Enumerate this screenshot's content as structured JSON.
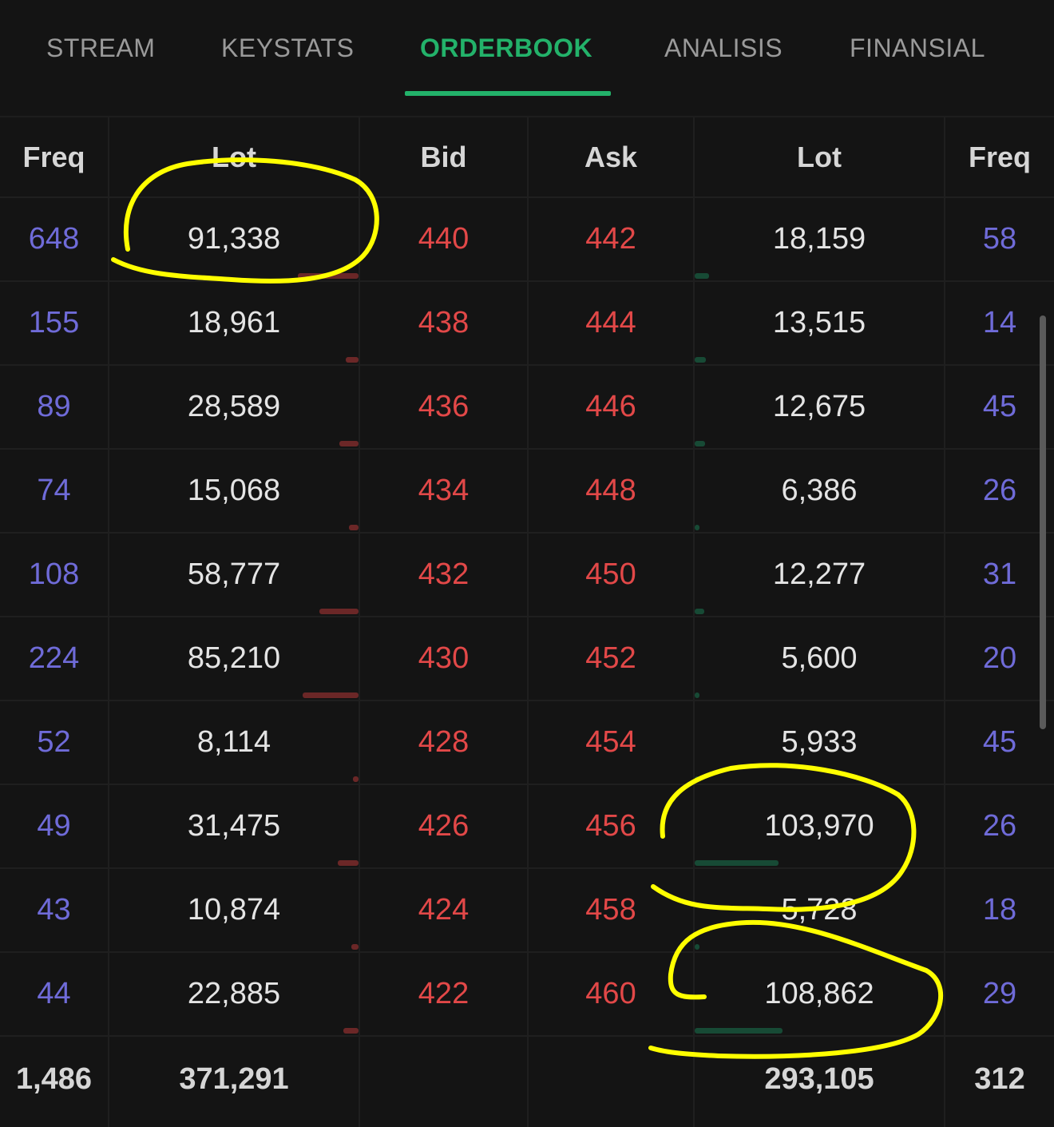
{
  "tabs": [
    {
      "label": "STREAM",
      "active": false
    },
    {
      "label": "KEYSTATS",
      "active": false
    },
    {
      "label": "ORDERBOOK",
      "active": true
    },
    {
      "label": "ANALISIS",
      "active": false
    },
    {
      "label": "FINANSIAL",
      "active": false
    }
  ],
  "orderbook": {
    "headers": {
      "bid_freq": "Freq",
      "bid_lot": "Lot",
      "bid": "Bid",
      "ask": "Ask",
      "ask_lot": "Lot",
      "ask_freq": "Freq"
    },
    "rows": [
      {
        "bid_freq": "648",
        "bid_lot": "91,338",
        "bid": "440",
        "ask": "442",
        "ask_lot": "18,159",
        "ask_freq": "58"
      },
      {
        "bid_freq": "155",
        "bid_lot": "18,961",
        "bid": "438",
        "ask": "444",
        "ask_lot": "13,515",
        "ask_freq": "14"
      },
      {
        "bid_freq": "89",
        "bid_lot": "28,589",
        "bid": "436",
        "ask": "446",
        "ask_lot": "12,675",
        "ask_freq": "45"
      },
      {
        "bid_freq": "74",
        "bid_lot": "15,068",
        "bid": "434",
        "ask": "448",
        "ask_lot": "6,386",
        "ask_freq": "26"
      },
      {
        "bid_freq": "108",
        "bid_lot": "58,777",
        "bid": "432",
        "ask": "450",
        "ask_lot": "12,277",
        "ask_freq": "31"
      },
      {
        "bid_freq": "224",
        "bid_lot": "85,210",
        "bid": "430",
        "ask": "452",
        "ask_lot": "5,600",
        "ask_freq": "20"
      },
      {
        "bid_freq": "52",
        "bid_lot": "8,114",
        "bid": "428",
        "ask": "454",
        "ask_lot": "5,933",
        "ask_freq": "45"
      },
      {
        "bid_freq": "49",
        "bid_lot": "31,475",
        "bid": "426",
        "ask": "456",
        "ask_lot": "103,970",
        "ask_freq": "26"
      },
      {
        "bid_freq": "43",
        "bid_lot": "10,874",
        "bid": "424",
        "ask": "458",
        "ask_lot": "5,728",
        "ask_freq": "18"
      },
      {
        "bid_freq": "44",
        "bid_lot": "22,885",
        "bid": "422",
        "ask": "460",
        "ask_lot": "108,862",
        "ask_freq": "29"
      }
    ],
    "totals": {
      "bid_freq": "1,486",
      "bid_lot": "371,291",
      "ask_lot": "293,105",
      "ask_freq": "312"
    }
  },
  "colors": {
    "accent": "#23b26a",
    "freq": "#6f6bd8",
    "price": "#e24848",
    "bid_bar": "#6b2727",
    "ask_bar": "#174a35",
    "annotation": "#ffff00"
  }
}
